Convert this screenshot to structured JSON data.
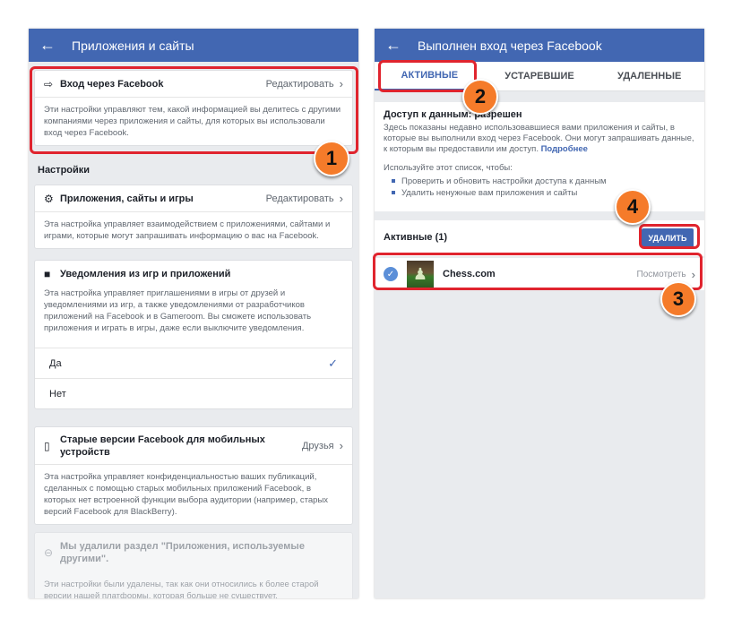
{
  "left": {
    "title": "Приложения и сайты",
    "login": {
      "label": "Вход через Facebook",
      "value": "Редактировать",
      "desc": "Эти настройки управляют тем, какой информацией вы делитесь с другими компаниями через приложения и сайты, для которых вы использовали вход через Facebook."
    },
    "settings_heading": "Настройки",
    "apps": {
      "label": "Приложения, сайты и игры",
      "value": "Редактировать",
      "desc": "Эта настройка управляет взаимодействием с приложениями, сайтами и играми, которые могут запрашивать информацию о вас на Facebook."
    },
    "notifications": {
      "label": "Уведомления из игр и приложений",
      "desc": "Эта настройка управляет приглашениями в игры от друзей и уведомлениями из игр, а также уведомлениями от разработчиков приложений на Facebook и в Gameroom. Вы сможете использовать приложения и играть в игры, даже если выключите уведомления.",
      "options": [
        "Да",
        "Нет"
      ],
      "selected": 0
    },
    "old_versions": {
      "label": "Старые версии Facebook для мобильных устройств",
      "value": "Друзья",
      "desc": "Эта настройка управляет конфиденциальностью ваших публикаций, сделанных с помощью старых мобильных приложений Facebook, в которых нет встроенной функции выбора аудитории (например, старых версий Facebook для BlackBerry)."
    },
    "removed": {
      "label": "Мы удалили раздел \"Приложения, используемые другими\".",
      "desc": "Эти настройки были удалены, так как они относились к более старой версии нашей платформы, которая больше не существует."
    }
  },
  "right": {
    "title": "Выполнен вход через Facebook",
    "tabs": [
      "АКТИВНЫЕ",
      "УСТАРЕВШИЕ",
      "УДАЛЕННЫЕ"
    ],
    "access": {
      "title": "Доступ к данным: разрешен",
      "desc": "Здесь показаны недавно использовавшиеся вами приложения и сайты, в которые вы выполнили вход через Facebook. Они могут запрашивать данные, к которым вы предоставили им доступ.",
      "more": "Подробнее",
      "use_title": "Используйте этот список, чтобы:",
      "bullets": [
        "Проверить и обновить настройки доступа к данным",
        "Удалить ненужные вам приложения и сайты"
      ]
    },
    "active": {
      "heading": "Активные (1)",
      "delete_label": "УДАЛИТЬ",
      "app_name": "Chess.com",
      "view_label": "Посмотреть"
    }
  },
  "badges": [
    "1",
    "2",
    "3",
    "4"
  ],
  "colors": {
    "brand": "#4267b2",
    "highlight": "#e0242e",
    "badge": "#f57b2a"
  }
}
